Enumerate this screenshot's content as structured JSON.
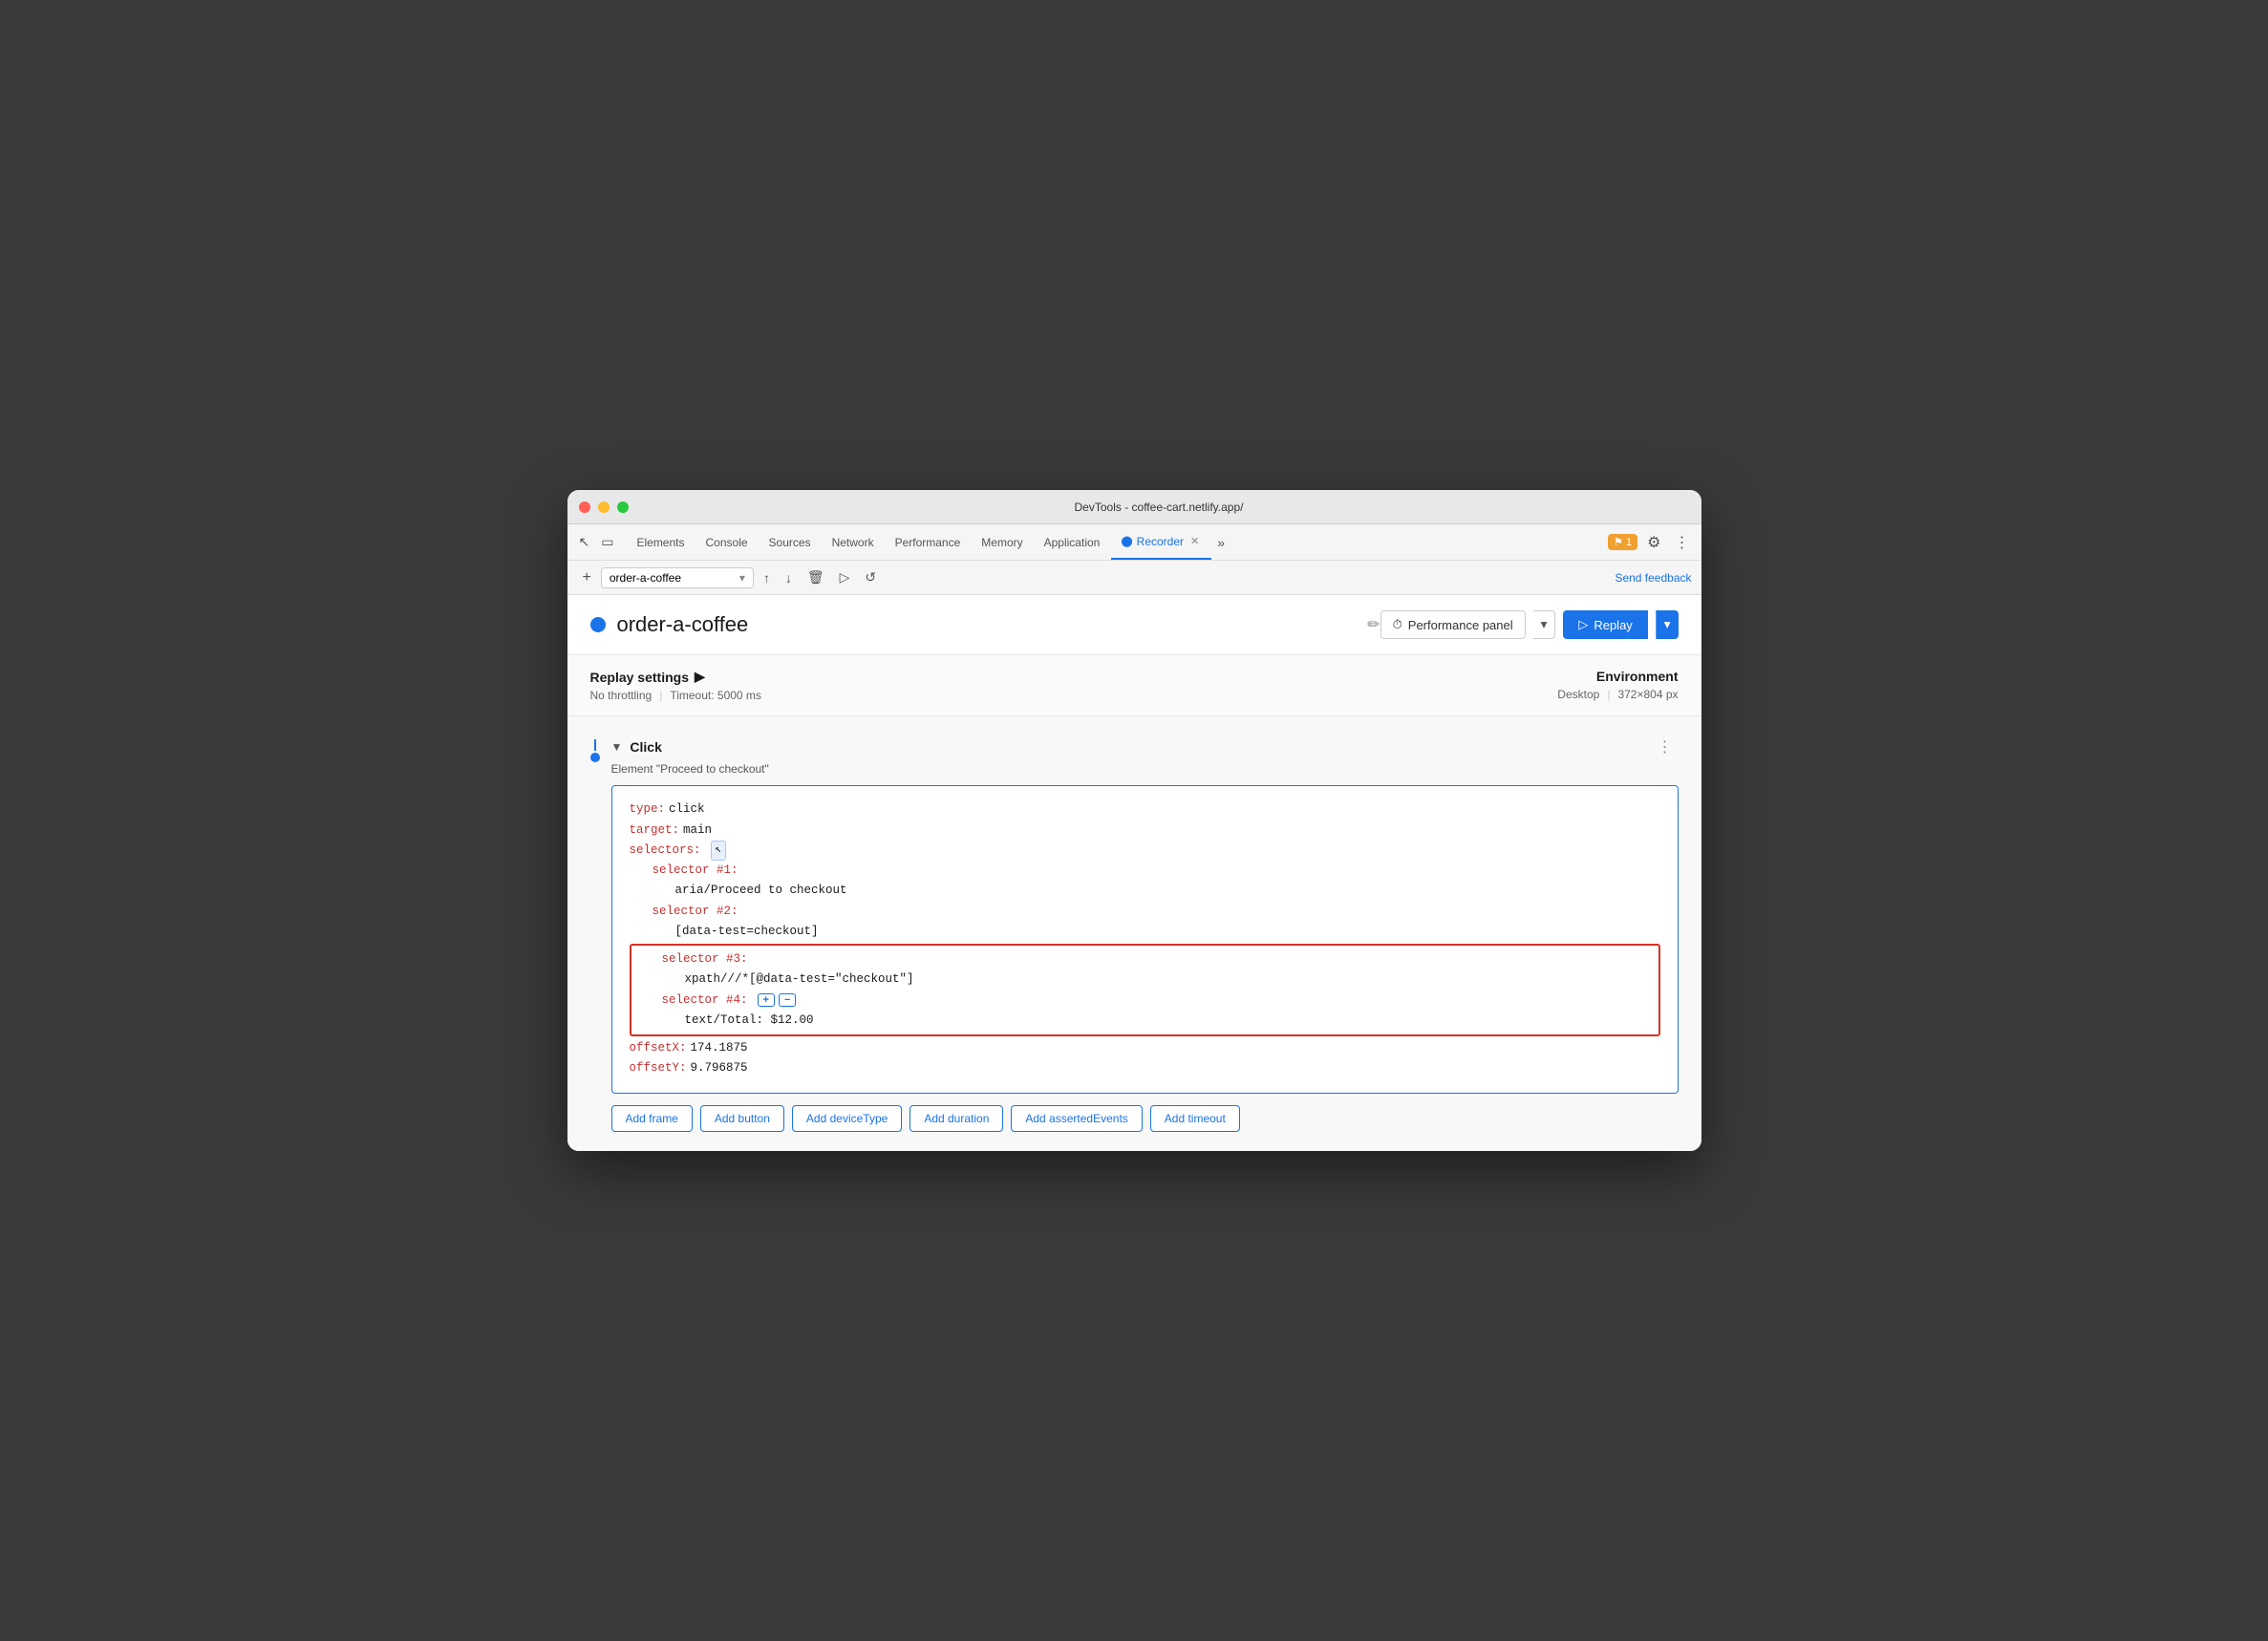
{
  "window": {
    "title": "DevTools - coffee-cart.netlify.app/"
  },
  "tabs": {
    "items": [
      {
        "id": "elements",
        "label": "Elements",
        "active": false
      },
      {
        "id": "console",
        "label": "Console",
        "active": false
      },
      {
        "id": "sources",
        "label": "Sources",
        "active": false
      },
      {
        "id": "network",
        "label": "Network",
        "active": false
      },
      {
        "id": "performance",
        "label": "Performance",
        "active": false
      },
      {
        "id": "memory",
        "label": "Memory",
        "active": false
      },
      {
        "id": "application",
        "label": "Application",
        "active": false
      },
      {
        "id": "recorder",
        "label": "Recorder",
        "active": true
      }
    ],
    "more_label": "»",
    "badge_count": "1"
  },
  "toolbar": {
    "recording_name": "order-a-coffee",
    "send_feedback": "Send feedback"
  },
  "recording": {
    "dot_color": "#1a73e8",
    "title": "order-a-coffee",
    "edit_icon": "✏️",
    "performance_panel_btn": "Performance panel",
    "replay_btn": "Replay"
  },
  "replay_settings": {
    "title": "Replay settings",
    "arrow": "▶",
    "throttling": "No throttling",
    "timeout": "Timeout: 5000 ms",
    "separator": "|"
  },
  "environment": {
    "title": "Environment",
    "device": "Desktop",
    "resolution": "372×804 px",
    "separator": "|"
  },
  "step": {
    "type": "Click",
    "description": "Element \"Proceed to checkout\"",
    "code": {
      "type_key": "type:",
      "type_val": " click",
      "target_key": "target:",
      "target_val": " main",
      "selectors_key": "selectors:",
      "selector1_key": "selector #1:",
      "selector1_val": "aria/Proceed to checkout",
      "selector2_key": "selector #2:",
      "selector2_val": "[data-test=checkout]",
      "selector3_key": "selector #3:",
      "selector3_val": "xpath///*[@data-test=\"checkout\"]",
      "selector4_key": "selector #4:",
      "selector4_val": "text/Total: $12.00",
      "offsetX_key": "offsetX:",
      "offsetX_val": " 174.1875",
      "offsetY_key": "offsetY:",
      "offsetY_val": " 9.796875"
    },
    "selector_icon": "↖",
    "add_btn": "+",
    "remove_btn": "−"
  },
  "action_buttons": [
    {
      "id": "add-frame",
      "label": "Add frame"
    },
    {
      "id": "add-button",
      "label": "Add button"
    },
    {
      "id": "add-devicetype",
      "label": "Add deviceType"
    },
    {
      "id": "add-duration",
      "label": "Add duration"
    },
    {
      "id": "add-assertedevents",
      "label": "Add assertedEvents"
    },
    {
      "id": "add-timeout",
      "label": "Add timeout"
    }
  ]
}
